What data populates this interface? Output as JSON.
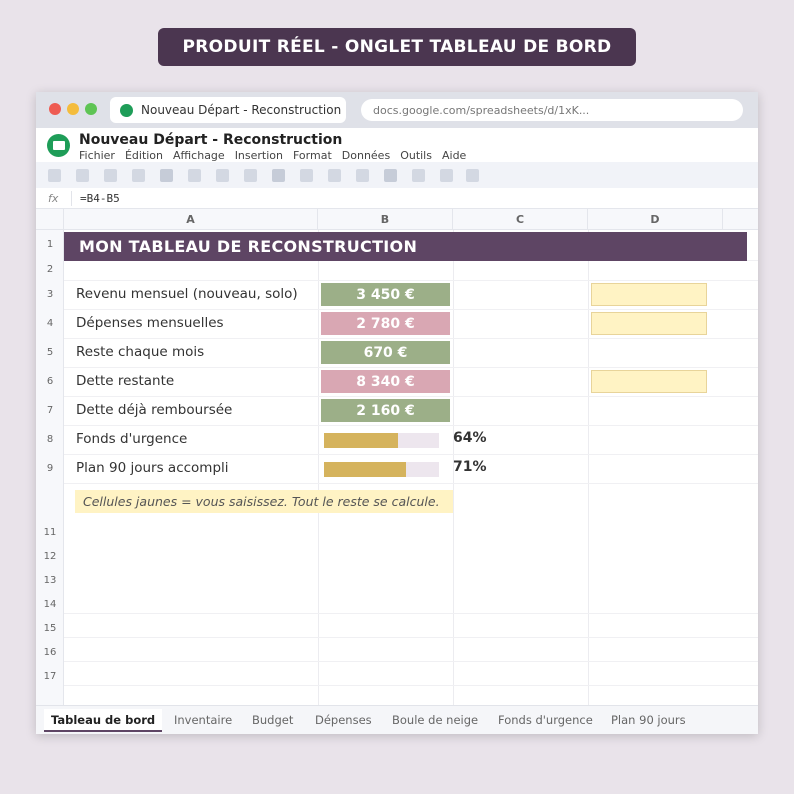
{
  "banner": "PRODUIT RÉEL - ONGLET TABLEAU DE BORD",
  "browser": {
    "tab_title": "Nouveau Départ - Reconstruction",
    "url": "docs.google.com/spreadsheets/d/1xK..."
  },
  "doc": {
    "title": "Nouveau Départ - Reconstruction",
    "menu": [
      "Fichier",
      "Édition",
      "Affichage",
      "Insertion",
      "Format",
      "Données",
      "Outils",
      "Aide"
    ]
  },
  "formula_bar": {
    "fx": "fx",
    "value": "=B4-B5"
  },
  "columns": [
    "A",
    "B",
    "C",
    "D"
  ],
  "row_numbers": [
    "1",
    "2",
    "3",
    "4",
    "5",
    "6",
    "7",
    "8",
    "9",
    "11",
    "12",
    "13",
    "14",
    "15",
    "16",
    "17"
  ],
  "dashboard": {
    "title": "MON TABLEAU DE RECONSTRUCTION",
    "rows": [
      {
        "label": "Revenu mensuel (nouveau, solo)",
        "value": "3 450 €",
        "color": "#9caf88"
      },
      {
        "label": "Dépenses mensuelles",
        "value": "2 780 €",
        "color": "#d9a7b3"
      },
      {
        "label": "Reste chaque mois",
        "value": "670 €",
        "color": "#9caf88"
      },
      {
        "label": "Dette restante",
        "value": "8 340 €",
        "color": "#d9a7b3"
      },
      {
        "label": "Dette déjà remboursée",
        "value": "2 160 €",
        "color": "#9caf88"
      }
    ],
    "progress": [
      {
        "label": "Fonds d'urgence",
        "percent": 64,
        "text": "64%"
      },
      {
        "label": "Plan 90 jours accompli",
        "percent": 71,
        "text": "71%"
      }
    ],
    "note": "Cellules jaunes = vous saisissez. Tout le reste se calcule."
  },
  "sheet_tabs": [
    "Tableau de bord",
    "Inventaire",
    "Budget",
    "Dépenses",
    "Boule de neige",
    "Fonds d'urgence",
    "Plan 90 jours"
  ],
  "colors": {
    "accent": "#5e4564",
    "banner": "#4b3650",
    "input": "#fff3c4",
    "progress": "#d5b35d"
  }
}
